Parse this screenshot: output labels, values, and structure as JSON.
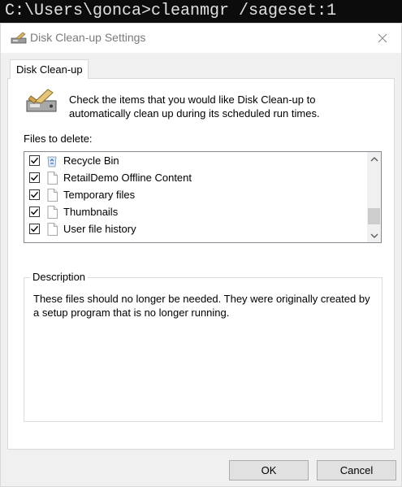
{
  "console": {
    "command": "C:\\Users\\gonca>cleanmgr /sageset:1"
  },
  "window": {
    "title": "Disk Clean-up Settings"
  },
  "tabs": [
    {
      "label": "Disk Clean-up"
    }
  ],
  "intro": {
    "text": "Check the items that you would like Disk Clean-up to automatically clean up during its scheduled run times."
  },
  "files": {
    "label": "Files to delete:",
    "items": [
      {
        "label": "Recycle Bin",
        "checked": true,
        "icon": "recycle-bin-icon"
      },
      {
        "label": "RetailDemo Offline Content",
        "checked": true,
        "icon": "file-icon"
      },
      {
        "label": "Temporary files",
        "checked": true,
        "icon": "file-icon"
      },
      {
        "label": "Thumbnails",
        "checked": true,
        "icon": "file-icon"
      },
      {
        "label": "User file history",
        "checked": true,
        "icon": "file-icon"
      }
    ]
  },
  "description": {
    "legend": "Description",
    "text": "These files should no longer be needed. They were originally created by a setup program that is no longer running."
  },
  "buttons": {
    "ok": "OK",
    "cancel": "Cancel"
  }
}
